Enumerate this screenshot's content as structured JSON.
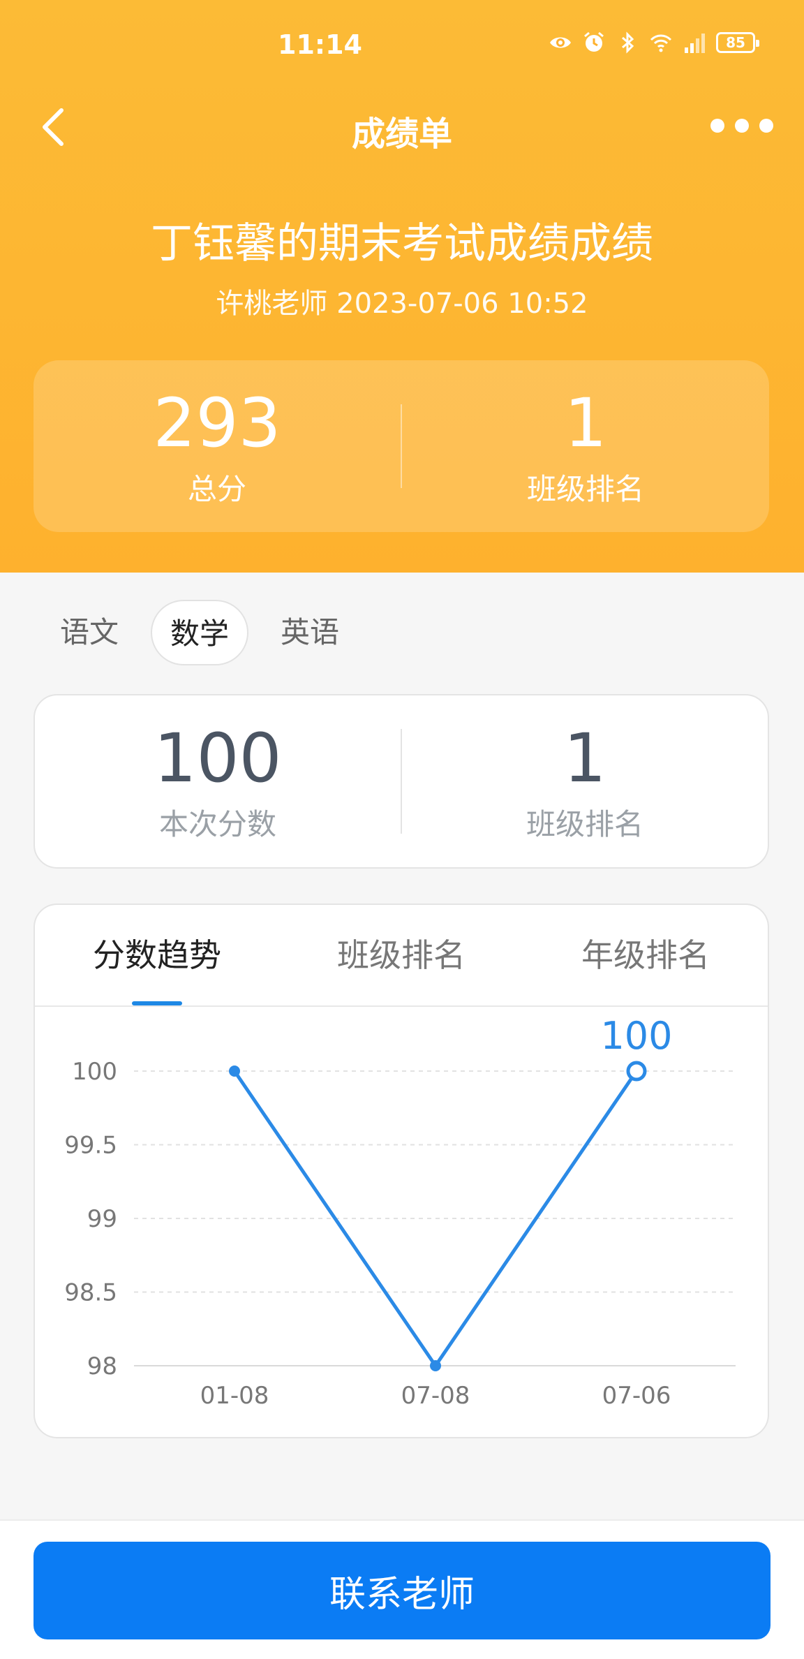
{
  "status_bar": {
    "time": "11:14",
    "battery": "85",
    "icons": [
      "eye-icon",
      "alarm-icon",
      "bluetooth-icon",
      "wifi-icon",
      "signal-icon"
    ]
  },
  "nav": {
    "title": "成绩单"
  },
  "exam": {
    "title": "丁钰馨的期末考试成绩成绩",
    "meta": "许桃老师 2023-07-06 10:52"
  },
  "summary": {
    "total_value": "293",
    "total_label": "总分",
    "rank_value": "1",
    "rank_label": "班级排名"
  },
  "subjects": {
    "tabs": [
      "语文",
      "数学",
      "英语"
    ],
    "active": "数学"
  },
  "score": {
    "value": "100",
    "value_label": "本次分数",
    "rank_value": "1",
    "rank_label": "班级排名"
  },
  "trend": {
    "tabs": [
      "分数趋势",
      "班级排名",
      "年级排名"
    ],
    "active": "分数趋势"
  },
  "chart_data": {
    "type": "line",
    "categories": [
      "01-08",
      "07-08",
      "07-06"
    ],
    "series": [
      {
        "values": [
          100,
          98,
          100
        ]
      }
    ],
    "ylim": [
      98,
      100
    ],
    "yticks": [
      "100",
      "99.5",
      "99",
      "98.5",
      "98"
    ],
    "highlight": {
      "index": 2,
      "label": "100"
    },
    "grid": true,
    "line_color": "#2b8ae6"
  },
  "bottom": {
    "contact_label": "联系老师"
  },
  "colors": {
    "header": "#feb12e",
    "primary": "#0b7cf4"
  }
}
